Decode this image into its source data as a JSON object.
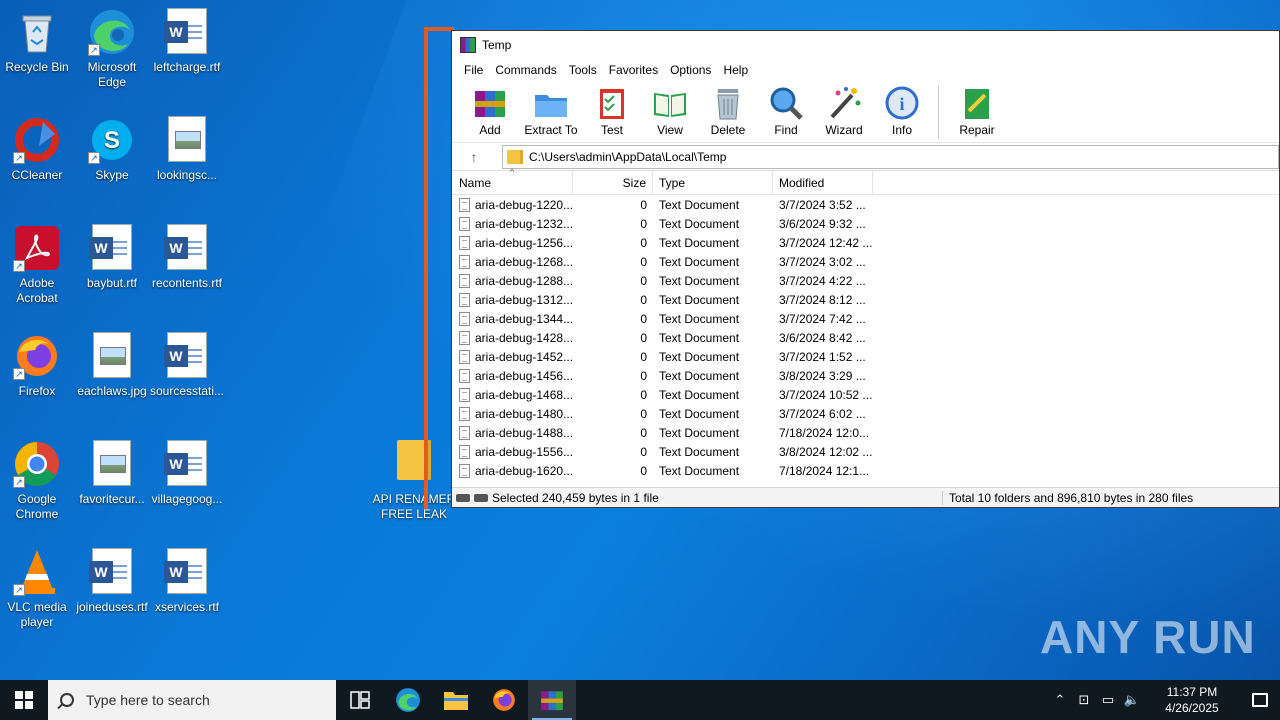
{
  "desktop": {
    "icons": [
      {
        "label": "Recycle Bin"
      },
      {
        "label": "Microsoft Edge"
      },
      {
        "label": "leftcharge.rtf"
      },
      {
        "label": "CCleaner"
      },
      {
        "label": "Skype"
      },
      {
        "label": "lookingsc..."
      },
      {
        "label": "Adobe Acrobat"
      },
      {
        "label": "baybut.rtf"
      },
      {
        "label": "recontents.rtf"
      },
      {
        "label": "Firefox"
      },
      {
        "label": "eachlaws.jpg"
      },
      {
        "label": "sourcesstati..."
      },
      {
        "label": "Google Chrome"
      },
      {
        "label": "favoritecur..."
      },
      {
        "label": "villagegoog..."
      },
      {
        "label": "VLC media player"
      },
      {
        "label": "joineduses.rtf"
      },
      {
        "label": "xservices.rtf"
      },
      {
        "label": "API RENAMER FREE LEAK"
      }
    ]
  },
  "winrar": {
    "title": "Temp",
    "menu": [
      "File",
      "Commands",
      "Tools",
      "Favorites",
      "Options",
      "Help"
    ],
    "toolbar": [
      "Add",
      "Extract To",
      "Test",
      "View",
      "Delete",
      "Find",
      "Wizard",
      "Info",
      "Repair"
    ],
    "address": "C:\\Users\\admin\\AppData\\Local\\Temp",
    "columns": {
      "name": "Name",
      "size": "Size",
      "type": "Type",
      "modified": "Modified"
    },
    "files": [
      {
        "name": "aria-debug-1220...",
        "size": "0",
        "type": "Text Document",
        "modified": "3/7/2024 3:52 ..."
      },
      {
        "name": "aria-debug-1232...",
        "size": "0",
        "type": "Text Document",
        "modified": "3/6/2024 9:32 ..."
      },
      {
        "name": "aria-debug-1256...",
        "size": "0",
        "type": "Text Document",
        "modified": "3/7/2024 12:42 ..."
      },
      {
        "name": "aria-debug-1268...",
        "size": "0",
        "type": "Text Document",
        "modified": "3/7/2024 3:02 ..."
      },
      {
        "name": "aria-debug-1288...",
        "size": "0",
        "type": "Text Document",
        "modified": "3/7/2024 4:22 ..."
      },
      {
        "name": "aria-debug-1312...",
        "size": "0",
        "type": "Text Document",
        "modified": "3/7/2024 8:12 ..."
      },
      {
        "name": "aria-debug-1344...",
        "size": "0",
        "type": "Text Document",
        "modified": "3/7/2024 7:42 ..."
      },
      {
        "name": "aria-debug-1428...",
        "size": "0",
        "type": "Text Document",
        "modified": "3/6/2024 8:42 ..."
      },
      {
        "name": "aria-debug-1452...",
        "size": "0",
        "type": "Text Document",
        "modified": "3/7/2024 1:52 ..."
      },
      {
        "name": "aria-debug-1456...",
        "size": "0",
        "type": "Text Document",
        "modified": "3/8/2024 3:29 ..."
      },
      {
        "name": "aria-debug-1468...",
        "size": "0",
        "type": "Text Document",
        "modified": "3/7/2024 10:52 ..."
      },
      {
        "name": "aria-debug-1480...",
        "size": "0",
        "type": "Text Document",
        "modified": "3/7/2024 6:02 ..."
      },
      {
        "name": "aria-debug-1488...",
        "size": "0",
        "type": "Text Document",
        "modified": "7/18/2024 12:0..."
      },
      {
        "name": "aria-debug-1556...",
        "size": "0",
        "type": "Text Document",
        "modified": "3/8/2024 12:02 ..."
      },
      {
        "name": "aria-debug-1620...",
        "size": "0",
        "type": "Text Document",
        "modified": "7/18/2024 12:1..."
      }
    ],
    "status_selected": "Selected 240,459 bytes in 1 file",
    "status_total": "Total 10 folders and 896,810 bytes in 280 files"
  },
  "watermark": "ANY RUN",
  "taskbar": {
    "search_placeholder": "Type here to search",
    "time": "11:37 PM",
    "date": "4/26/2025"
  },
  "colors": {
    "accent_frame": "#e25c22",
    "taskbar": "#101820"
  }
}
